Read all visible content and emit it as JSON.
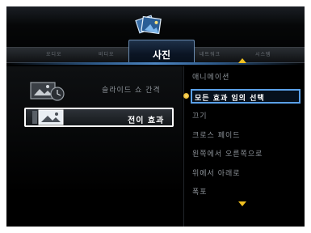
{
  "tabs": [
    "오디오",
    "비디오",
    "사진",
    "네트워크",
    "시스템"
  ],
  "active_tab": "사진",
  "left_menu": [
    {
      "label": "슬라이드 쇼 간격",
      "icon": "photo-clock-icon"
    },
    {
      "label": "전이 효과",
      "icon": "photo-transition-icon"
    }
  ],
  "options": [
    "애니메이션",
    "모든 효과 임의 선택",
    "끄기",
    "크로스 페이드",
    "왼쪽에서 오른쪽으로",
    "위에서 아래로",
    "폭포"
  ],
  "selected_option": "모든 효과 임의 선택",
  "colors": {
    "accent_blue": "#5aa0e8",
    "arrow_yellow": "#f0c020",
    "background": "#000000"
  }
}
